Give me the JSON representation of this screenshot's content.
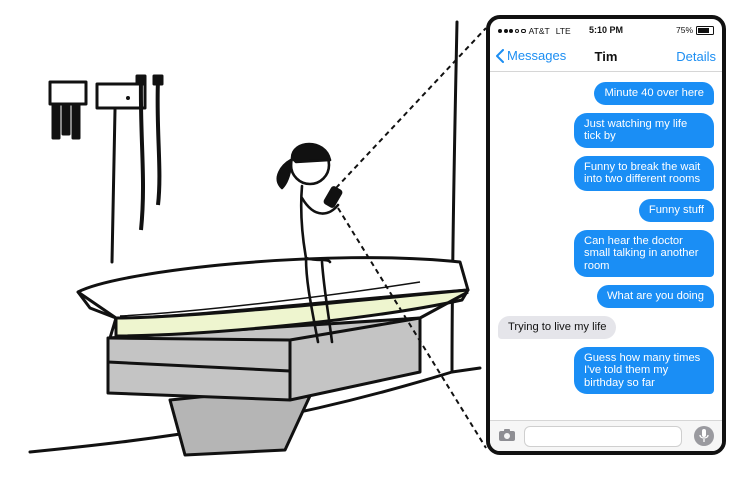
{
  "status_bar": {
    "carrier": "AT&T",
    "network": "LTE",
    "time": "5:10 PM",
    "battery": "75%",
    "battery_level": 0.75
  },
  "nav": {
    "back_label": "Messages",
    "contact_name": "Tim",
    "details_label": "Details"
  },
  "messages": [
    {
      "direction": "out",
      "text": "Minute 40 over here"
    },
    {
      "direction": "out",
      "text": "Just watching my life tick by"
    },
    {
      "direction": "out",
      "text": "Funny to break the wait into two different rooms"
    },
    {
      "direction": "out",
      "text": "Funny stuff"
    },
    {
      "direction": "out",
      "text": "Can hear the doctor small talking in another room"
    },
    {
      "direction": "out",
      "text": "What are you doing"
    },
    {
      "direction": "in",
      "text": "Trying to live my life"
    },
    {
      "direction": "out",
      "text": "Guess how many times I've told them my birthday so far"
    }
  ],
  "input_bar": {
    "camera_icon": "camera-icon",
    "mic_icon": "microphone-icon"
  },
  "colors": {
    "bubble_out": "#1a8ef5",
    "bubble_in": "#e5e5ea",
    "link": "#1c8ef2",
    "table_cushion": "#eef5cf",
    "table_base": "#b5b5b5"
  }
}
